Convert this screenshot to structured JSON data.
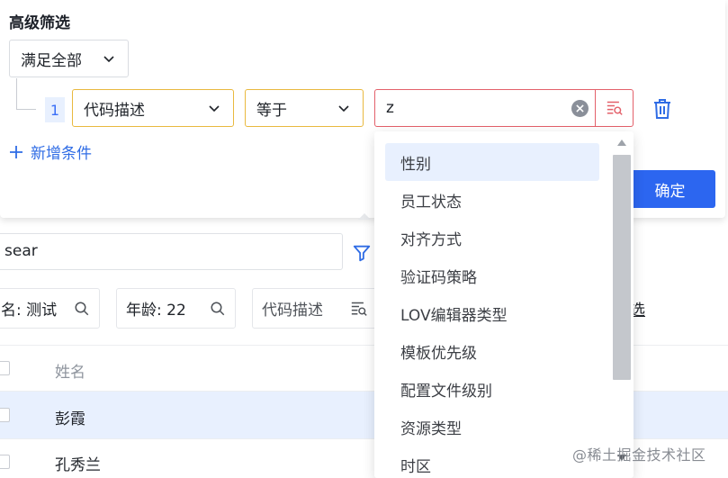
{
  "filter_panel": {
    "title": "高级筛选",
    "match_mode": "满足全部",
    "conditions": [
      {
        "index": "1",
        "field": "代码描述",
        "operator": "等于",
        "value": "z"
      }
    ],
    "add_condition_label": "新增条件",
    "confirm_label": "确定"
  },
  "dropdown": {
    "options": [
      "性别",
      "员工状态",
      "对齐方式",
      "验证码策略",
      "LOV编辑器类型",
      "模板优先级",
      "配置文件级别",
      "资源类型",
      "时区"
    ],
    "selected_index": 0
  },
  "table_area": {
    "search_value": "sear",
    "chips": [
      {
        "label": "名:",
        "value": "测试"
      },
      {
        "label": "年龄:",
        "value": "22"
      },
      {
        "label": "代码描述",
        "value": ""
      }
    ],
    "partial_link": "选",
    "column_header": "姓名",
    "rows": [
      "彭霞",
      "孔秀兰"
    ]
  },
  "watermark": "@稀土掘金技术社区",
  "colors": {
    "primary": "#2c66f0",
    "warning_border": "#e9b93f",
    "error_border": "#e3606a",
    "selected_bg": "#e8f0fe"
  }
}
